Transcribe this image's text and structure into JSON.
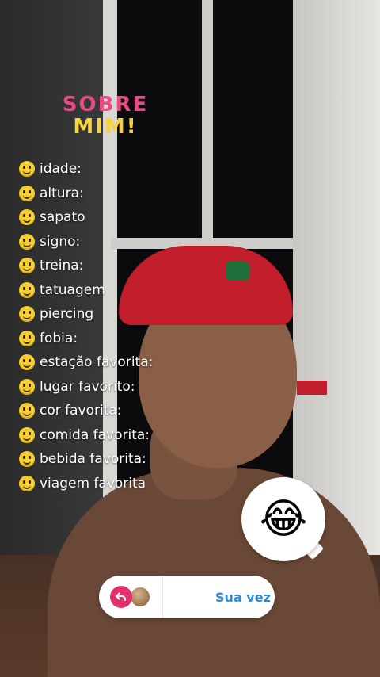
{
  "title": {
    "line1": "SOBRE",
    "line2": "MIM!"
  },
  "questions": [
    "idade:",
    "altura:",
    "sapato",
    "signo:",
    "treina:",
    "tatuagem",
    "piercing",
    "fobia:",
    "estação favorita:",
    "lugar favorito:",
    "cor favorita:",
    "comida favorita:",
    "bebida favorita:",
    "viagem favorita"
  ],
  "reaction": {
    "emoji": "😂",
    "icon": "laughing-emoji"
  },
  "reply_bar": {
    "label": "Sua vez",
    "reply_icon": "reply-arrow-icon",
    "accent": "#e1306c",
    "link_color": "#2a8bd8"
  }
}
